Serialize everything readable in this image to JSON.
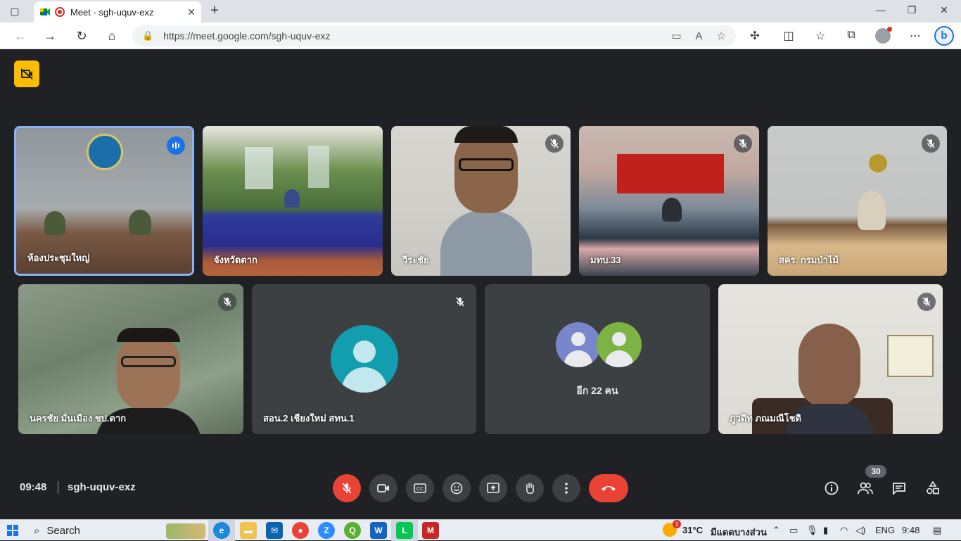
{
  "browser": {
    "tab_title": "Meet - sgh-uquv-exz",
    "url": "https://meet.google.com/sgh-uquv-exz",
    "new_tab": "+",
    "close_tab": "✕",
    "window_minimize": "—",
    "window_maximize": "❐",
    "window_close": "✕"
  },
  "meeting": {
    "time": "09:48",
    "code": "sgh-uquv-exz",
    "participant_count": "30",
    "others_label": "อีก 22 คน"
  },
  "participants": [
    {
      "name": "ห้องประชุมใหญ่",
      "state": "speaking"
    },
    {
      "name": "จังหวัดตาก",
      "state": "none"
    },
    {
      "name": "วีระชัย",
      "state": "muted"
    },
    {
      "name": "มทบ.33",
      "state": "muted"
    },
    {
      "name": "สคร. กรมป่าไม้",
      "state": "muted"
    },
    {
      "name": "นครชัย มั่นเมือง ชป.ตาก",
      "state": "muted"
    },
    {
      "name": "สอน.2 เชียงใหม่ สทน.1",
      "state": "muted"
    },
    {
      "name": "ภูวดิท ภณมณีโชติ",
      "state": "muted"
    }
  ],
  "others_avatar_colors": [
    "#7986cb",
    "#7cb342"
  ],
  "avatar_color": "#129eaf",
  "taskbar": {
    "search_label": "Search",
    "weather": "31°C",
    "weather_desc": "มีแดดบางส่วน",
    "language": "ENG",
    "clock": "9:48"
  },
  "colors": {
    "meet_bg": "#202124",
    "hangup": "#ea4335",
    "accent": "#1a73e8",
    "caption_badge": "#fbbc04"
  }
}
